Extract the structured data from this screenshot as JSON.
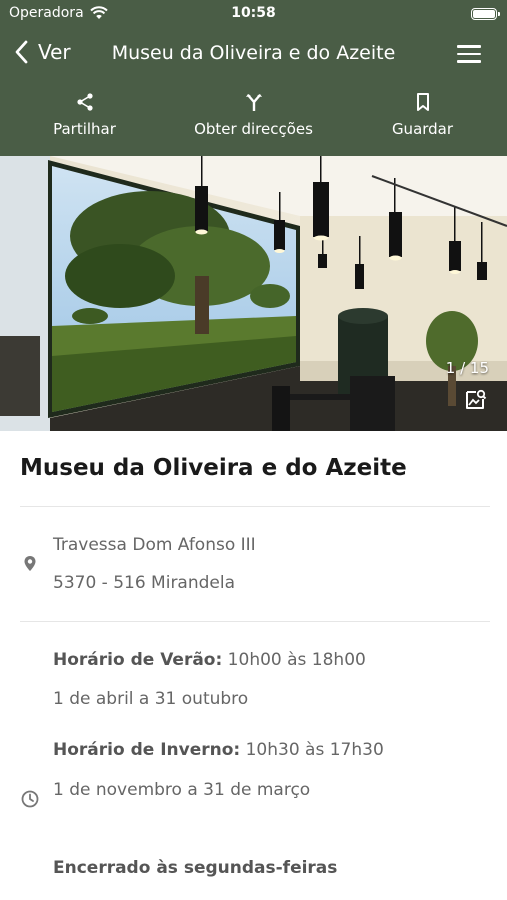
{
  "status_bar": {
    "carrier": "Operadora",
    "time": "10:58"
  },
  "nav": {
    "back_label": "Ver",
    "title": "Museu da Oliveira e do Azeite"
  },
  "actions": [
    {
      "label": "Partilhar",
      "icon": "share-icon"
    },
    {
      "label": "Obter direcções",
      "icon": "directions-icon"
    },
    {
      "label": "Guardar",
      "icon": "bookmark-icon"
    }
  ],
  "gallery": {
    "counter": "1 / 15"
  },
  "place": {
    "name": "Museu da Oliveira e do Azeite",
    "address_line1": "Travessa Dom Afonso III",
    "address_line2": "5370 - 516 Mirandela"
  },
  "hours": {
    "summer_label": "Horário de Verão:",
    "summer_time": " 10h00 às 18h00",
    "summer_dates": "1 de abril a 31 outubro",
    "winter_label": "Horário de Inverno:",
    "winter_time": " 10h30 às 17h30",
    "winter_dates": "1 de novembro a 31 de março",
    "closed": "Encerrado às segundas-feiras"
  },
  "colors": {
    "header": "#4a5d46",
    "text": "#222222",
    "muted": "#666666"
  }
}
